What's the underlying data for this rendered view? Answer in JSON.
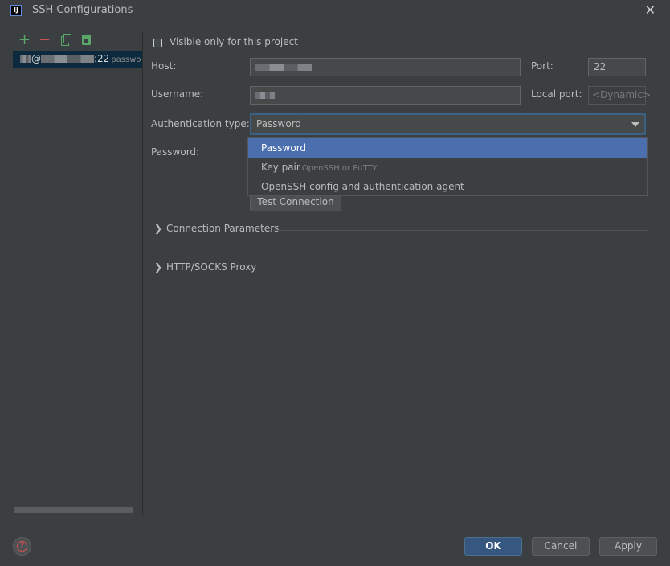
{
  "window": {
    "title": "SSH Configurations",
    "logo_text": "IJ"
  },
  "colors": {
    "accent": "#4b6eaf",
    "background": "#3c3f41",
    "field_bg": "#45494a",
    "add": "#59a869",
    "remove": "#c75450",
    "help": "#d9534f"
  },
  "sidebar": {
    "toolbar": {
      "add_symbol": "+",
      "remove_symbol": "−"
    },
    "config_item": {
      "port_label": ":22",
      "auth_label": "passwo"
    }
  },
  "form": {
    "visible_only_label": "Visible only for this project",
    "host_label": "Host:",
    "port_label": "Port:",
    "port_value": "22",
    "username_label": "Username:",
    "local_port_label": "Local port:",
    "local_port_placeholder": "<Dynamic>",
    "auth_type_label": "Authentication type:",
    "auth_type_value": "Password",
    "password_label": "Password:",
    "auth_options": [
      {
        "label": "Password",
        "sub": ""
      },
      {
        "label": "Key pair",
        "sub": "OpenSSH or PuTTY"
      },
      {
        "label": "OpenSSH config and authentication agent",
        "sub": ""
      }
    ],
    "test_connection_label": "Test Connection",
    "sections": [
      {
        "label": "Connection Parameters",
        "arrow": "❯"
      },
      {
        "label": "HTTP/SOCKS Proxy",
        "arrow": "❯"
      }
    ]
  },
  "footer": {
    "help_symbol": "?",
    "ok_label": "OK",
    "cancel_label": "Cancel",
    "apply_label": "Apply"
  }
}
